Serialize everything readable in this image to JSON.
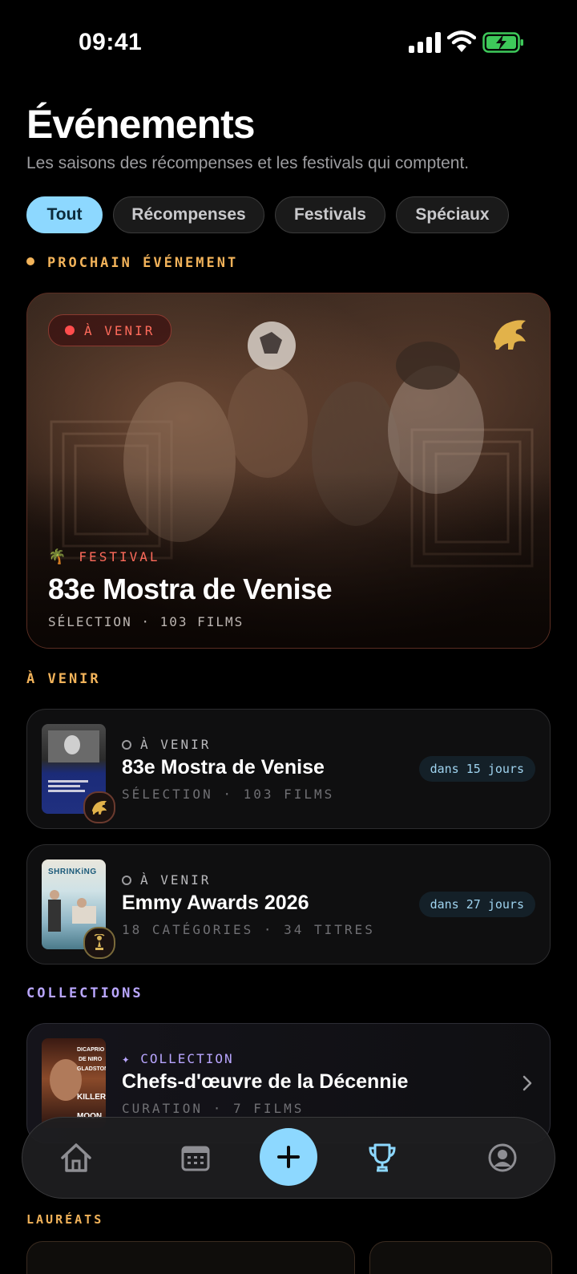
{
  "status_bar": {
    "time": "09:41"
  },
  "header": {
    "title": "Événements",
    "subtitle": "Les saisons des récompenses et les festivals qui comptent."
  },
  "filters": [
    {
      "label": "Tout",
      "active": true
    },
    {
      "label": "Récompenses",
      "active": false
    },
    {
      "label": "Festivals",
      "active": false
    },
    {
      "label": "Spéciaux",
      "active": false
    }
  ],
  "next_event": {
    "section_label": "PROCHAIN ÉVÉNEMENT",
    "badge": "À VENIR",
    "type": "FESTIVAL",
    "title": "83e Mostra de Venise",
    "meta": "SÉLECTION · 103 FILMS"
  },
  "upcoming": {
    "section_label": "À VENIR",
    "items": [
      {
        "status": "À VENIR",
        "title": "83e Mostra de Venise",
        "meta": "SÉLECTION · 103 FILMS",
        "countdown": "dans 15 jours"
      },
      {
        "status": "À VENIR",
        "title": "Emmy Awards 2026",
        "meta": "18 CATÉGORIES · 34 TITRES",
        "countdown": "dans 27 jours"
      }
    ]
  },
  "collections": {
    "section_label": "COLLECTIONS",
    "items": [
      {
        "type": "✦ COLLECTION",
        "title": "Chefs-d'œuvre de la Décennie",
        "meta": "CURATION · 7 FILMS"
      }
    ]
  },
  "laureats": {
    "section_label": "LAURÉATS"
  },
  "nav": {
    "items": [
      "home-icon",
      "calendar-icon",
      "plus-icon",
      "trophy-icon",
      "profile-icon"
    ]
  },
  "colors": {
    "accent": "#8dd8ff",
    "gold": "#f2b35a",
    "live_red": "#ff4d4d",
    "collection_purple": "#b9a6ff"
  }
}
